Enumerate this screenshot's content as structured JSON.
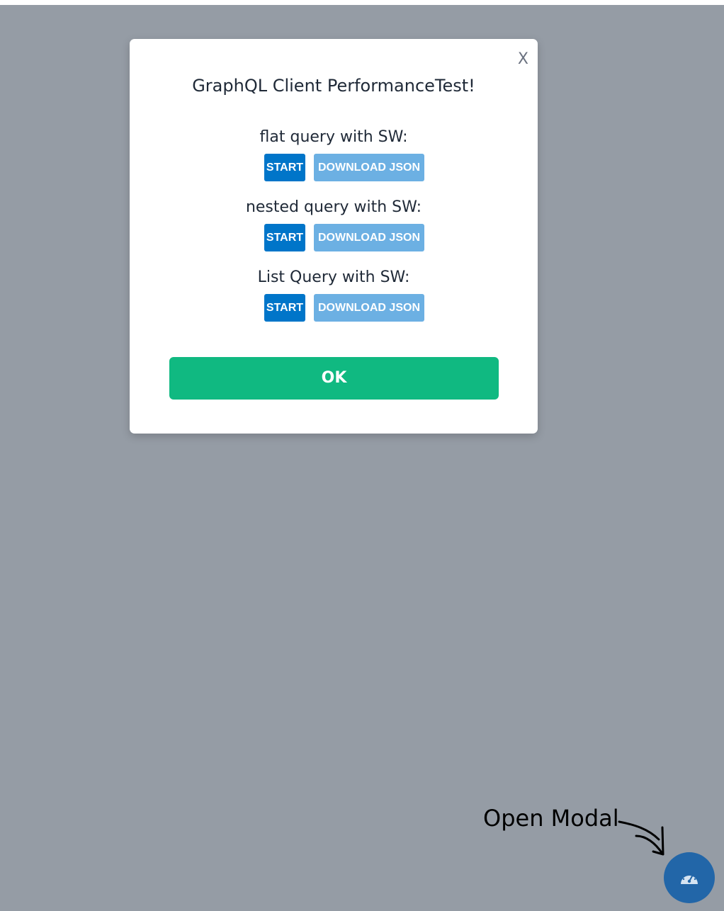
{
  "modal": {
    "close_label": "X",
    "title": "GraphQL Client PerformanceTest!",
    "sections": [
      {
        "label": "flat query with SW:",
        "start_label": "START",
        "download_label": "DOWNLOAD JSON"
      },
      {
        "label": "nested query with SW:",
        "start_label": "START",
        "download_label": "DOWNLOAD JSON"
      },
      {
        "label": "List Query with SW:",
        "start_label": "START",
        "download_label": "DOWNLOAD JSON"
      }
    ],
    "ok_label": "OK"
  },
  "annotation": {
    "text": "Open Modal"
  },
  "fab": {
    "icon": "speedometer-icon"
  },
  "colors": {
    "overlay": "#959ca5",
    "start_button": "#0075c9",
    "download_button": "#6cb0e3",
    "ok_button": "#10b981",
    "fab": "#2266a8"
  }
}
